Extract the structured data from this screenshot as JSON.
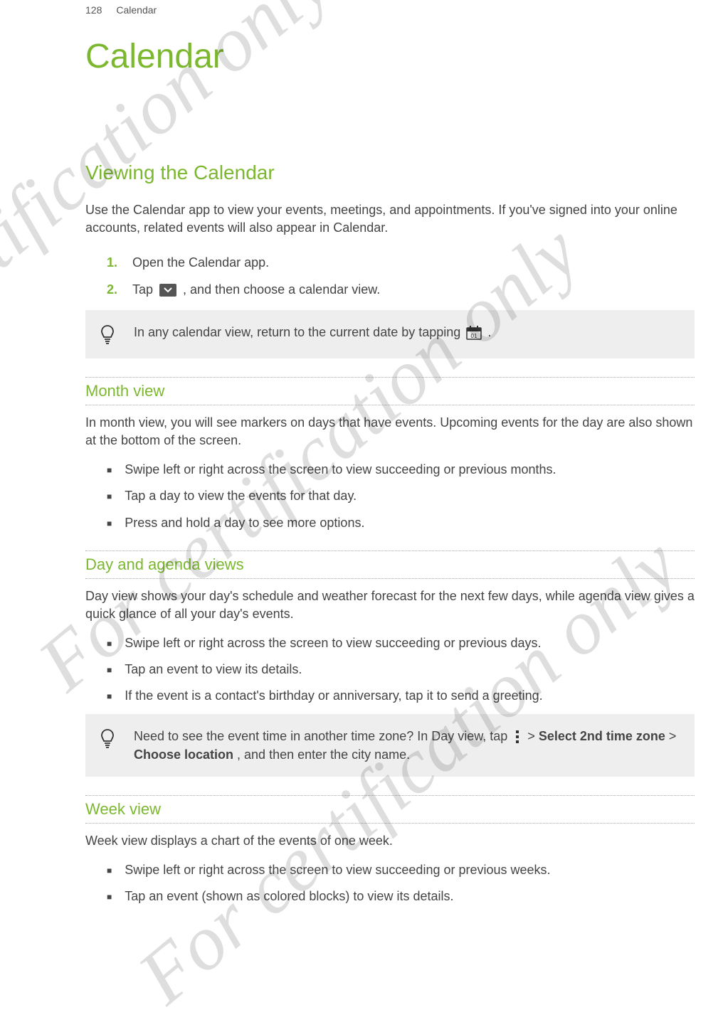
{
  "header": {
    "page_number": "128",
    "section": "Calendar"
  },
  "title": "Calendar",
  "section1": {
    "heading": "Viewing the Calendar",
    "intro": "Use the Calendar app to view your events, meetings, and appointments. If you've signed into your online accounts, related events will also appear in Calendar.",
    "steps": {
      "n1": "1.",
      "s1": "Open the Calendar app.",
      "n2": "2.",
      "s2_before": "Tap ",
      "s2_after": " , and then choose a calendar view."
    },
    "tip1_before": "In any calendar view, return to the current date by tapping ",
    "tip1_after": " ."
  },
  "month_view": {
    "heading": "Month view",
    "intro": "In month view, you will see markers on days that have events. Upcoming events for the day are also shown at the bottom of the screen.",
    "bullets": [
      "Swipe left or right across the screen to view succeeding or previous months.",
      "Tap a day to view the events for that day.",
      "Press and hold a day to see more options."
    ]
  },
  "day_view": {
    "heading": "Day and agenda views",
    "intro": "Day view shows your day's schedule and weather forecast for the next few days, while agenda view gives a quick glance of all your day's events.",
    "bullets": [
      "Swipe left or right across the screen to view succeeding or previous days.",
      "Tap an event to view its details.",
      "If the event is a contact's birthday or anniversary, tap it to send a greeting."
    ],
    "tip_before": "Need to see the event time in another time zone? In Day view, tap ",
    "tip_mid1": " > ",
    "tip_bold1": "Select 2nd time zone",
    "tip_mid2": " > ",
    "tip_bold2": "Choose location",
    "tip_after": ", and then enter the city name."
  },
  "week_view": {
    "heading": "Week view",
    "intro": "Week view displays a chart of the events of one week.",
    "bullets": [
      "Swipe left or right across the screen to view succeeding or previous weeks.",
      "Tap an event (shown as colored blocks) to view its details."
    ]
  },
  "watermark": "For certification only"
}
